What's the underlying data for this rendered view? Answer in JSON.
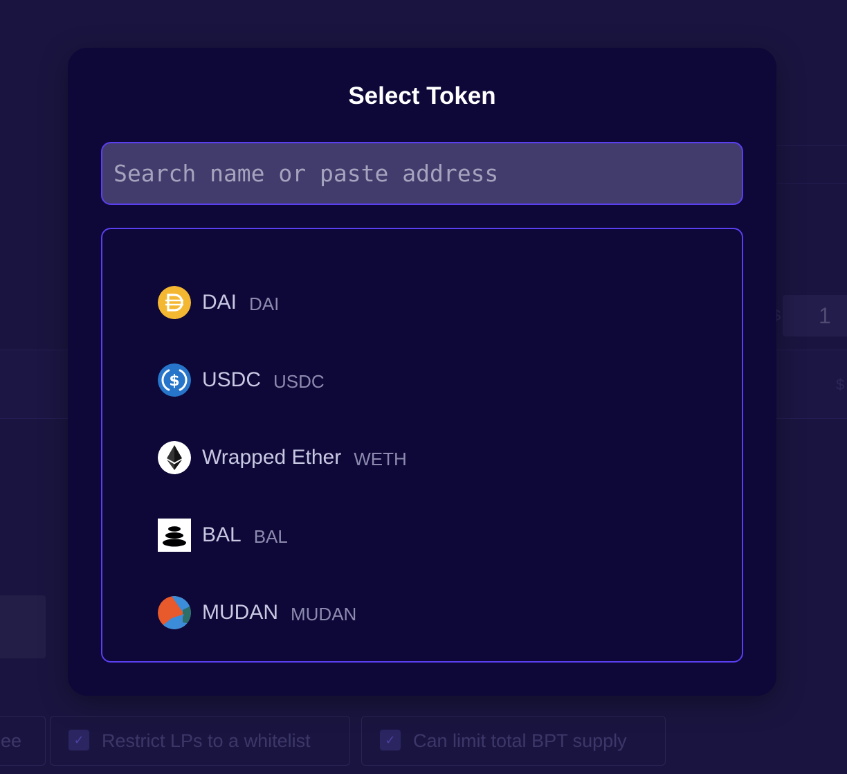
{
  "background": {
    "input_value": "1",
    "currency_symbol": "$",
    "left_fragment": "ee",
    "options": [
      {
        "label": "Restrict LPs to a whitelist",
        "checked": true
      },
      {
        "label": "Can limit total BPT supply",
        "checked": true
      }
    ]
  },
  "modal": {
    "title": "Select Token",
    "search": {
      "placeholder": "Search name or paste address",
      "value": ""
    },
    "tokens": [
      {
        "name": "DAI",
        "symbol": "DAI",
        "icon": "dai-icon",
        "color": "#f4b731"
      },
      {
        "name": "USDC",
        "symbol": "USDC",
        "icon": "usdc-icon",
        "color": "#2775ca"
      },
      {
        "name": "Wrapped Ether",
        "symbol": "WETH",
        "icon": "weth-icon",
        "color": "#ffffff"
      },
      {
        "name": "BAL",
        "symbol": "BAL",
        "icon": "bal-icon",
        "color": "#000000"
      },
      {
        "name": "MUDAN",
        "symbol": "MUDAN",
        "icon": "mudan-icon",
        "color": "#e8592b"
      }
    ]
  },
  "colors": {
    "accent": "#5b3ef0",
    "modal_bg": "#0d0838",
    "page_bg": "#1a1540"
  }
}
